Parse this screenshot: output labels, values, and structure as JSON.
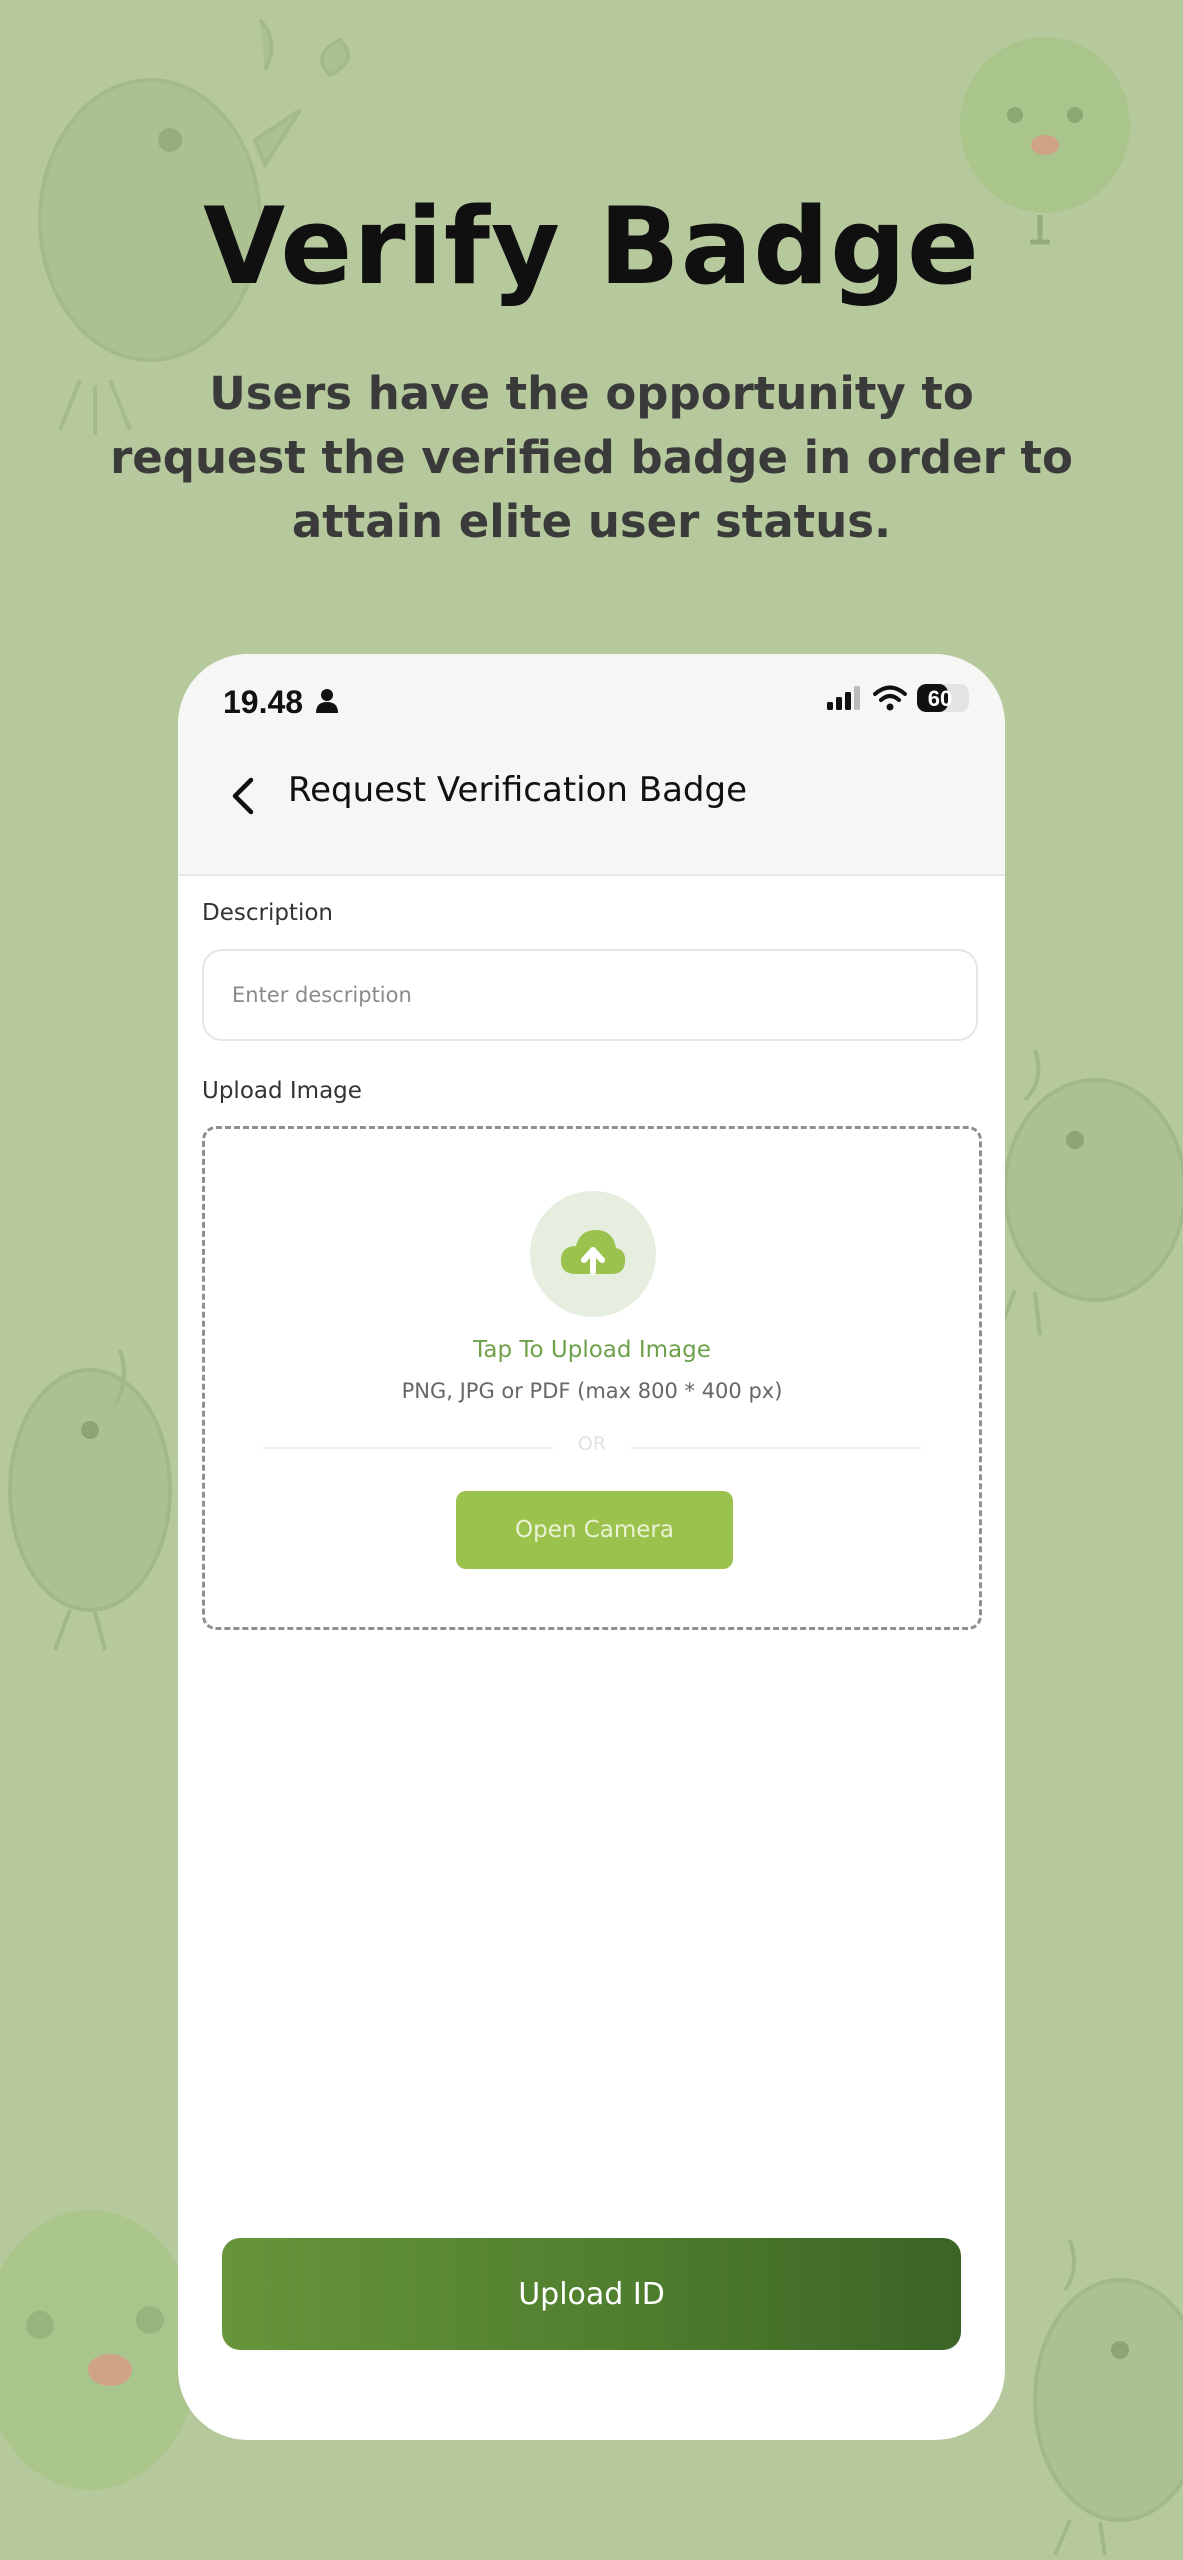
{
  "promo": {
    "title": "Verify Badge",
    "subtitle": "Users have the opportunity to request the verified badge in order to attain elite user status."
  },
  "status_bar": {
    "time": "19.48",
    "battery": "60",
    "battery_level": 0.6
  },
  "nav": {
    "title": "Request Verification Badge"
  },
  "form": {
    "description_label": "Description",
    "description_placeholder": "Enter description",
    "description_value": "",
    "upload_label": "Upload Image",
    "tap_to_upload": "Tap To Upload Image",
    "file_hint": "PNG, JPG or PDF (max 800 * 400 px)",
    "or_text": "OR",
    "open_camera": "Open Camera"
  },
  "footer": {
    "upload_id": "Upload ID"
  },
  "colors": {
    "background": "#b6c99c",
    "accent_green": "#9cc24e",
    "primary_button": "#4f7e2e",
    "upload_text": "#6fa04a"
  },
  "icons": {
    "back": "chevron-left-icon",
    "upload": "cloud-upload-icon",
    "person": "person-icon",
    "signal": "signal-icon",
    "wifi": "wifi-icon",
    "battery": "battery-icon"
  }
}
